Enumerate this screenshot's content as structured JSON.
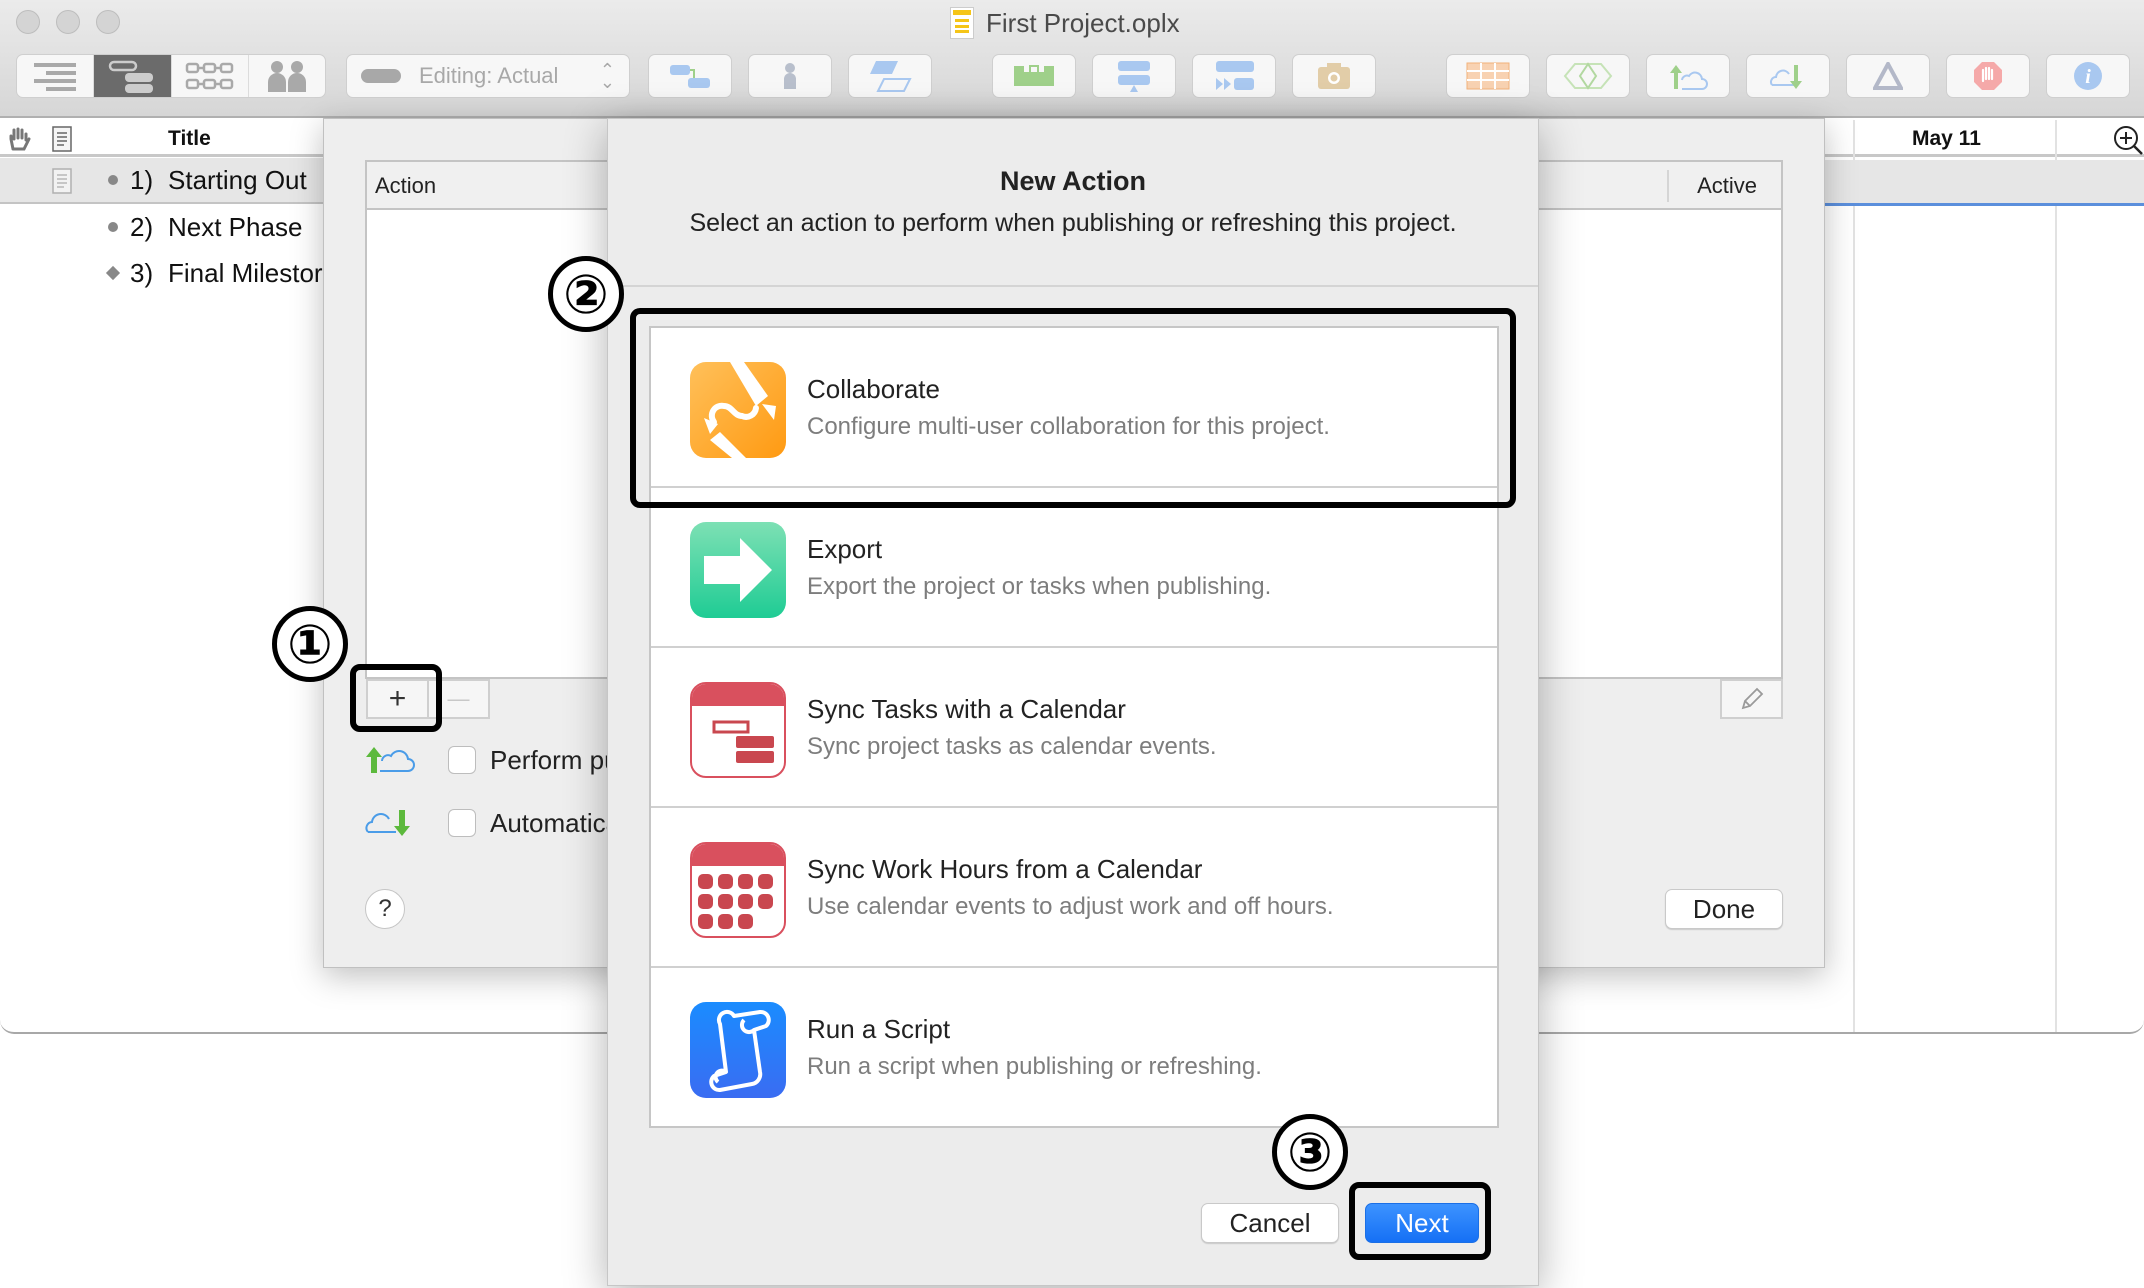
{
  "window": {
    "title": "First Project.oplx",
    "traffic_lights": [
      "close",
      "minimize",
      "zoom"
    ]
  },
  "toolbar": {
    "view_modes": [
      {
        "name": "outline-view",
        "icon": "outline-icon",
        "active": false
      },
      {
        "name": "gantt-view",
        "icon": "gantt-icon",
        "active": true
      },
      {
        "name": "network-view",
        "icon": "network-icon",
        "active": false
      },
      {
        "name": "resource-view",
        "icon": "people-icon",
        "active": false
      }
    ],
    "editing_mode": "Editing: Actual",
    "buttons": [
      {
        "name": "connect-tasks",
        "icon": "dependency-icon"
      },
      {
        "name": "add-resource",
        "icon": "person-icon"
      },
      {
        "name": "add-task",
        "icon": "task-icon"
      },
      {
        "name": "level-resources",
        "icon": "level-icon"
      },
      {
        "name": "catch-up",
        "icon": "catch-up-icon"
      },
      {
        "name": "reschedule",
        "icon": "reschedule-icon"
      },
      {
        "name": "baseline-snapshot",
        "icon": "camera-icon"
      },
      {
        "name": "styles",
        "icon": "table-icon"
      },
      {
        "name": "filter",
        "icon": "diamond-icon"
      },
      {
        "name": "publish",
        "icon": "cloud-up-icon"
      },
      {
        "name": "refresh",
        "icon": "cloud-down-icon"
      },
      {
        "name": "violations",
        "icon": "delta-icon"
      },
      {
        "name": "stop",
        "icon": "stop-hand-icon"
      },
      {
        "name": "inspector",
        "icon": "info-icon"
      }
    ],
    "accent_colors": {
      "blue": "#a9c8f0",
      "green": "#9fd08a",
      "orange": "#f2b27a",
      "red": "#f08080",
      "tan": "#d9b98a"
    }
  },
  "outline": {
    "column_title": "Title",
    "date_header": "May 11",
    "rows": [
      {
        "number": "1)",
        "title": "Starting Out",
        "marker": "bullet",
        "selected": true
      },
      {
        "number": "2)",
        "title": "Next Phase",
        "marker": "bullet",
        "selected": false
      },
      {
        "number": "3)",
        "title": "Final Milestor",
        "marker": "diamond",
        "selected": false
      }
    ]
  },
  "publish_sheet": {
    "columns": {
      "action": "Action",
      "active": "Active"
    },
    "add_label": "+",
    "remove_label": "—",
    "options": [
      {
        "label": "Perform pu",
        "icon": "cloud-upload-icon",
        "checked": false
      },
      {
        "label": "Automatica",
        "icon": "cloud-download-icon",
        "checked": false
      }
    ],
    "help_label": "?",
    "done_label": "Done"
  },
  "dialog": {
    "title": "New Action",
    "subtitle": "Select an action to perform when publishing or refreshing this project.",
    "actions": [
      {
        "name": "Collaborate",
        "description": "Configure multi-user collaboration for this project.",
        "icon": "collaborate-icon",
        "color": "#ff9f1a",
        "selected": true
      },
      {
        "name": "Export",
        "description": "Export the project or tasks when publishing.",
        "icon": "export-arrow-icon",
        "color": "#2fd49a"
      },
      {
        "name": "Sync Tasks with a Calendar",
        "description": "Sync project tasks as calendar events.",
        "icon": "calendar-tasks-icon",
        "color": "#d9505e"
      },
      {
        "name": "Sync Work Hours from a Calendar",
        "description": "Use calendar events to adjust work and off hours.",
        "icon": "calendar-grid-icon",
        "color": "#d9505e"
      },
      {
        "name": "Run a Script",
        "description": "Run a script when publishing or refreshing.",
        "icon": "script-scroll-icon",
        "color": "#1f7cf5"
      }
    ],
    "cancel_label": "Cancel",
    "next_label": "Next"
  },
  "annotations": {
    "step1": "①",
    "step2": "②",
    "step3": "③"
  }
}
